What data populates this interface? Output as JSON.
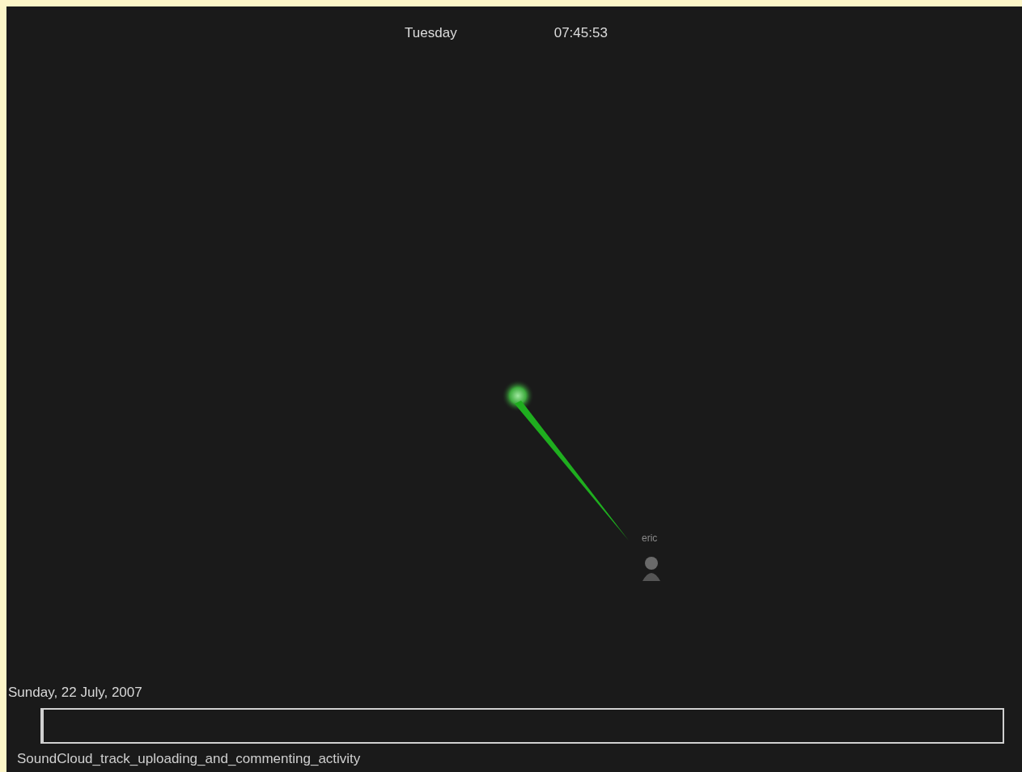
{
  "header": {
    "day": "Tuesday",
    "time": "07:45:53"
  },
  "graph": {
    "nodes": [
      {
        "kind": "file"
      }
    ],
    "users": [
      {
        "name": "eric"
      }
    ]
  },
  "timeline": {
    "date": "Sunday, 22 July, 2007",
    "level": 0
  },
  "caption": "SoundCloud_track_uploading_and_commenting_activity"
}
